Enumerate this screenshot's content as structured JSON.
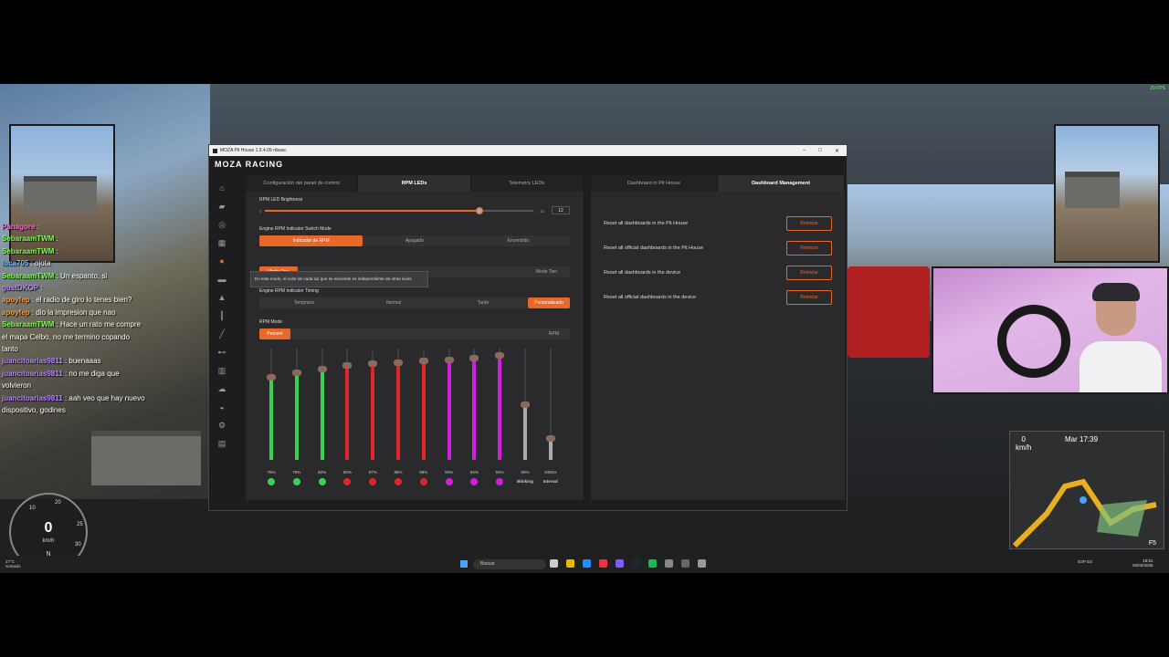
{
  "window": {
    "title": "MOZA Pit House 1.3.4.09 rdsasc",
    "brand": "MOZA RACING"
  },
  "left_panel": {
    "tabs": [
      "Configuración del panel de control",
      "RPM LEDs",
      "Telemetry LEDs"
    ],
    "selected_tab": 1,
    "brightness": {
      "label": "RPM LED Brightness",
      "min": "0",
      "max": "15",
      "value": "12",
      "fraction": 0.8
    },
    "switch_mode": {
      "label": "Engine RPM Indicator Switch Mode",
      "options": [
        "Indicador de RPM",
        "Apagado",
        "Encendido"
      ],
      "selected": 0
    },
    "tooltip": "En esta modo, el color de cada luz que se enciende es independiente de otras luces",
    "mode": {
      "options": [
        "Mode One",
        "Mode Two"
      ],
      "selected": 0
    },
    "timing": {
      "label": "Engine RPM Indicator Timing",
      "options": [
        "Temprano",
        "Normal",
        "Tarde",
        "Personalizado"
      ],
      "selected": 3
    },
    "rpm_mode": {
      "label": "RPM Mode",
      "options": [
        "Percent",
        "RPM"
      ],
      "selected": 0
    },
    "leds": [
      {
        "pct": "75%",
        "level": 0.75,
        "color": "#39d353"
      },
      {
        "pct": "79%",
        "level": 0.79,
        "color": "#39d353"
      },
      {
        "pct": "82%",
        "level": 0.82,
        "color": "#39d353"
      },
      {
        "pct": "85%",
        "level": 0.85,
        "color": "#e0262b"
      },
      {
        "pct": "87%",
        "level": 0.87,
        "color": "#e0262b"
      },
      {
        "pct": "88%",
        "level": 0.88,
        "color": "#e0262b"
      },
      {
        "pct": "89%",
        "level": 0.89,
        "color": "#e0262b"
      },
      {
        "pct": "90%",
        "level": 0.9,
        "color": "#d11ee0"
      },
      {
        "pct": "92%",
        "level": 0.92,
        "color": "#d11ee0"
      },
      {
        "pct": "94%",
        "level": 0.94,
        "color": "#d11ee0"
      }
    ],
    "blinking": {
      "pct": "50%",
      "label": "Blinking",
      "level": 0.5
    },
    "interval": {
      "pct": "100ms",
      "label": "Interval",
      "level": 0.2
    }
  },
  "right_panel": {
    "tabs": [
      "Dashboard in Pit House",
      "Dashboard Management"
    ],
    "selected_tab": 1,
    "rows": [
      {
        "label": "Reset all dashboards in the Pit House",
        "button": "Reiniciar"
      },
      {
        "label": "Reset all official dashboards in the Pit House",
        "button": "Reiniciar"
      },
      {
        "label": "Reset all dashboards in the device",
        "button": "Reiniciar"
      },
      {
        "label": "Reset all official dashboards in the device",
        "button": "Reiniciar"
      }
    ]
  },
  "chat": [
    {
      "user": "Panagore",
      "text": ":",
      "color": "#ff6ad5"
    },
    {
      "user": "SebaraamTWM",
      "text": ":",
      "color": "#7cff4f"
    },
    {
      "user": "SebaraamTWM",
      "text": ":",
      "color": "#7cff4f"
    },
    {
      "user": "luca705",
      "text": ": ojota",
      "color": "#6fb7ff"
    },
    {
      "user": "SebaraamTWM",
      "text": ": Un espanto, si",
      "color": "#7cff4f"
    },
    {
      "user": "gustDKOP",
      "text": ":",
      "color": "#b884ff"
    },
    {
      "user": "apoyfep",
      "text": ": el radio de giro lo tenes bien?",
      "color": "#ff9a3c"
    },
    {
      "user": "apoyfep",
      "text": ": dio la impresion que nao",
      "color": "#ff9a3c"
    },
    {
      "user": "SebaraamTWM",
      "text": ": Hace un rato me compre el mapa Celbo, no me termino copando tanto",
      "color": "#7cff4f"
    },
    {
      "user": "juancitoarias9811",
      "text": ": buenaaas",
      "color": "#b884ff"
    },
    {
      "user": "juancitoarias9811",
      "text": ": no me diga que volvieron",
      "color": "#b884ff"
    },
    {
      "user": "juancitoarias9811",
      "text": ": aah veo que hay nuevo dispositivo, godines",
      "color": "#b884ff"
    }
  ],
  "hud": {
    "speed": "0",
    "speed_unit": "km/h",
    "compass": "N",
    "ticks": [
      "10",
      "20",
      "25",
      "30"
    ],
    "map_time": "Mar 17:39",
    "map_speed": "0",
    "map_speed_unit": "km/h",
    "f5": "F5",
    "fps": "29 FPS"
  },
  "taskbar": {
    "weather_temp": "27°C",
    "weather_desc": "Soleado",
    "search_placeholder": "Buscar",
    "lang": "ESP",
    "region": "ES",
    "time": "18:51",
    "date": "25/02/2026"
  }
}
